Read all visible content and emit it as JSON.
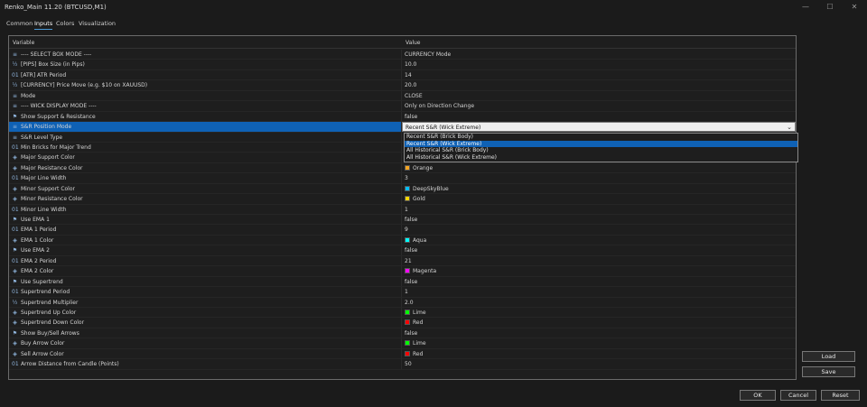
{
  "window": {
    "title": "Renko_Main 11.20 (BTCUSD,M1)",
    "minimize": "—",
    "maximize": "☐",
    "close": "✕"
  },
  "tabs": [
    {
      "label": "Common"
    },
    {
      "label": "Inputs"
    },
    {
      "label": "Colors"
    },
    {
      "label": "Visualization"
    }
  ],
  "table": {
    "col_variable": "Variable",
    "col_value": "Value",
    "rows": [
      {
        "icon": "enum-icon",
        "variable": "---- SELECT BOX MODE ----",
        "value": "CURRENCY Mode"
      },
      {
        "icon": "double-icon",
        "variable": "[PIPS] Box Size (in Pips)",
        "value": "10.0"
      },
      {
        "icon": "int-icon",
        "variable": "[ATR] ATR Period",
        "value": "14"
      },
      {
        "icon": "double-icon",
        "variable": "[CURRENCY] Price Move (e.g. $10 on XAUUSD)",
        "value": "20.0"
      },
      {
        "icon": "enum-icon",
        "variable": "Mode",
        "value": "CLOSE"
      },
      {
        "icon": "enum-icon",
        "variable": "---- WICK DISPLAY MODE ----",
        "value": "Only on Direction Change"
      },
      {
        "icon": "bool-icon",
        "variable": "Show Support & Resistance",
        "value": "false"
      },
      {
        "icon": "enum-icon",
        "variable": "S&R Position Mode",
        "value": "Recent S&R (Wick Extreme)"
      },
      {
        "icon": "enum-icon",
        "variable": "S&R Level Type",
        "value": ""
      },
      {
        "icon": "int-icon",
        "variable": "Min Bricks for Major Trend",
        "value": ""
      },
      {
        "icon": "color-icon",
        "variable": "Major Support Color",
        "value": ""
      },
      {
        "icon": "color-icon",
        "variable": "Major Resistance Color",
        "value": "Orange",
        "color": "#f5a623"
      },
      {
        "icon": "int-icon",
        "variable": "Major Line Width",
        "value": "3"
      },
      {
        "icon": "color-icon",
        "variable": "Minor Support Color",
        "value": "DeepSkyBlue",
        "color": "#00bfff"
      },
      {
        "icon": "color-icon",
        "variable": "Minor Resistance Color",
        "value": "Gold",
        "color": "#ffd700"
      },
      {
        "icon": "int-icon",
        "variable": "Minor Line Width",
        "value": "1"
      },
      {
        "icon": "bool-icon",
        "variable": "Use EMA 1",
        "value": "false"
      },
      {
        "icon": "int-icon",
        "variable": "EMA 1 Period",
        "value": "9"
      },
      {
        "icon": "color-icon",
        "variable": "EMA 1 Color",
        "value": "Aqua",
        "color": "#00ffff"
      },
      {
        "icon": "bool-icon",
        "variable": "Use EMA 2",
        "value": "false"
      },
      {
        "icon": "int-icon",
        "variable": "EMA 2 Period",
        "value": "21"
      },
      {
        "icon": "color-icon",
        "variable": "EMA 2 Color",
        "value": "Magenta",
        "color": "#ff00ff"
      },
      {
        "icon": "bool-icon",
        "variable": "Use Supertrend",
        "value": "false"
      },
      {
        "icon": "int-icon",
        "variable": "Supertrend Period",
        "value": "1"
      },
      {
        "icon": "double-icon",
        "variable": "Supertrend Multiplier",
        "value": "2.0"
      },
      {
        "icon": "color-icon",
        "variable": "Supertrend Up Color",
        "value": "Lime",
        "color": "#00ff00"
      },
      {
        "icon": "color-icon",
        "variable": "Supertrend Down Color",
        "value": "Red",
        "color": "#ff0000"
      },
      {
        "icon": "bool-icon",
        "variable": "Show Buy/Sell Arrows",
        "value": "false"
      },
      {
        "icon": "color-icon",
        "variable": "Buy Arrow Color",
        "value": "Lime",
        "color": "#00ff00"
      },
      {
        "icon": "color-icon",
        "variable": "Sell Arrow Color",
        "value": "Red",
        "color": "#ff0000"
      },
      {
        "icon": "int-icon",
        "variable": "Arrow Distance from Candle (Points)",
        "value": "50"
      }
    ]
  },
  "combo": {
    "selected": "Recent S&R (Wick Extreme)",
    "options": [
      "Recent S&R (Brick Body)",
      "Recent S&R (Wick Extreme)",
      "All Historical S&R (Brick Body)",
      "All Historical S&R (Wick Extreme)"
    ]
  },
  "buttons": {
    "load": "Load",
    "save": "Save",
    "ok": "OK",
    "cancel": "Cancel",
    "reset": "Reset"
  },
  "colors": {
    "selection": "#0f61b5",
    "background": "#1b1b1b"
  }
}
